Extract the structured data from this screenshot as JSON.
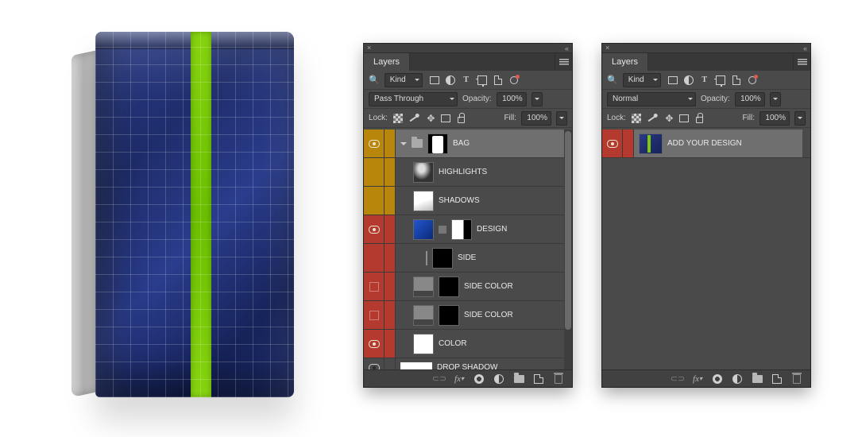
{
  "product": {
    "accent": "#7cc90c",
    "base": "#243783"
  },
  "panels": [
    {
      "id": "p1",
      "tab": "Layers",
      "filter_label": "Kind",
      "blend_mode": "Pass Through",
      "opacity_label": "Opacity:",
      "opacity_value": "100%",
      "lock_label": "Lock:",
      "fill_label": "Fill:",
      "fill_value": "100%",
      "layers": [
        {
          "id": "bag",
          "name": "BAG",
          "vis": "orange",
          "selected": true,
          "group": true
        },
        {
          "id": "highlights",
          "name": "HIGHLIGHTS",
          "vis": "orange"
        },
        {
          "id": "shadows",
          "name": "SHADOWS",
          "vis": "orange"
        },
        {
          "id": "design",
          "name": "DESIGN",
          "vis": "red",
          "hasMask": true
        },
        {
          "id": "side",
          "name": "SIDE",
          "vis": "red",
          "indent": true
        },
        {
          "id": "sidecolor1",
          "name": "SIDE COLOR",
          "vis": "red",
          "noeye": true
        },
        {
          "id": "sidecolor2",
          "name": "SIDE COLOR",
          "vis": "red",
          "noeye": true
        },
        {
          "id": "color",
          "name": "COLOR",
          "vis": "red"
        },
        {
          "id": "dropshadow",
          "name": "DROP SHADOW",
          "vis": "dark",
          "small": true
        }
      ]
    },
    {
      "id": "p2",
      "tab": "Layers",
      "filter_label": "Kind",
      "blend_mode": "Normal",
      "opacity_label": "Opacity:",
      "opacity_value": "100%",
      "lock_label": "Lock:",
      "fill_label": "Fill:",
      "fill_value": "100%",
      "layers": [
        {
          "id": "addyourdesign",
          "name": "ADD YOUR DESIGN",
          "vis": "red",
          "selected": true,
          "wide": true
        }
      ]
    }
  ],
  "icons": {
    "filter": [
      "image-icon",
      "adjust-icon",
      "type-icon",
      "shape-icon",
      "smart-icon",
      "artboard-icon"
    ],
    "bottom": [
      "link-icon",
      "fx-icon",
      "mask-icon",
      "adjustment-icon",
      "group-icon",
      "new-layer-icon",
      "trash-icon"
    ]
  }
}
